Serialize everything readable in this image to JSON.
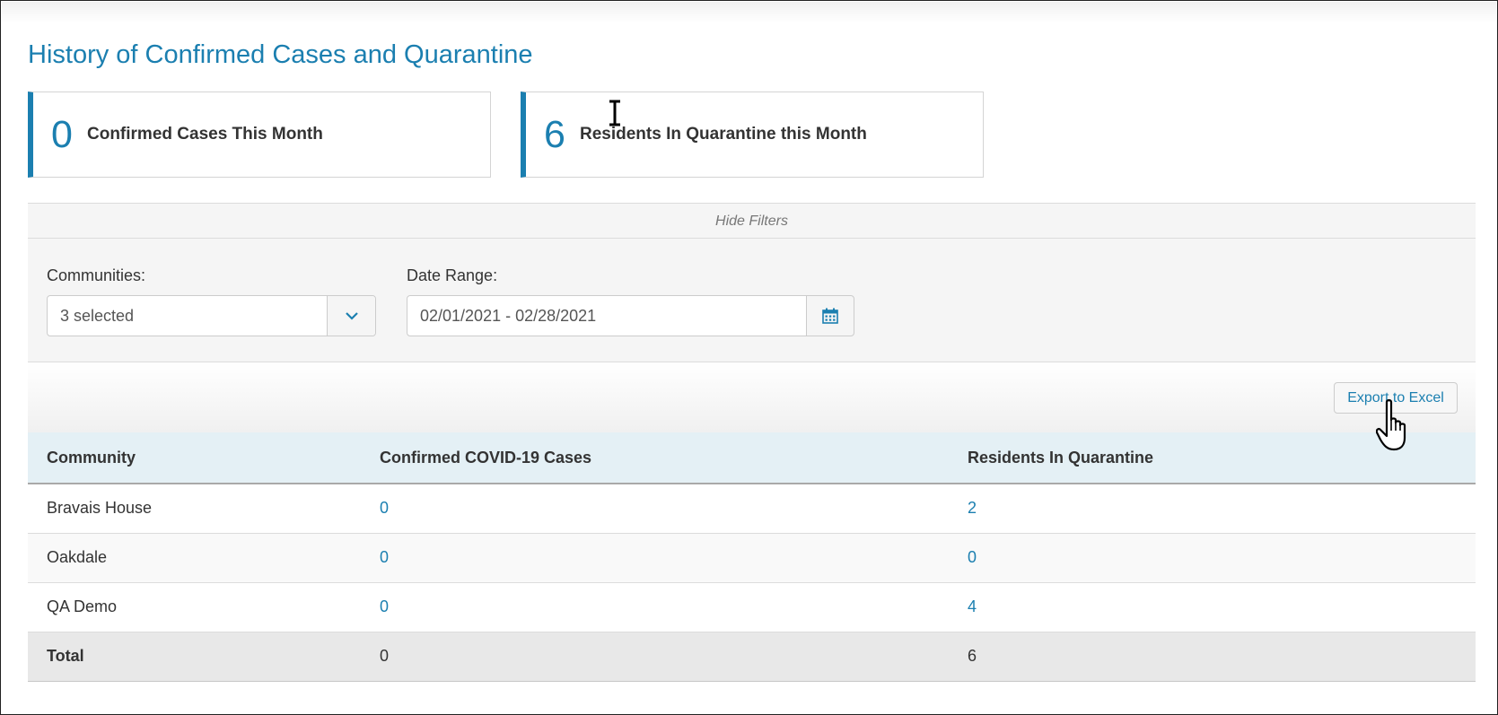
{
  "page_title": "History of Confirmed Cases and Quarantine",
  "stats": [
    {
      "value": "0",
      "label": "Confirmed Cases This Month"
    },
    {
      "value": "6",
      "label": "Residents In Quarantine this Month"
    }
  ],
  "filters": {
    "toggle_label": "Hide Filters",
    "communities_label": "Communities:",
    "communities_value": "3 selected",
    "date_range_label": "Date Range:",
    "date_range_value": "02/01/2021 - 02/28/2021"
  },
  "export_label": "Export to Excel",
  "table": {
    "headers": [
      "Community",
      "Confirmed COVID-19 Cases",
      "Residents In Quarantine"
    ],
    "rows": [
      {
        "community": "Bravais House",
        "confirmed": "0",
        "quarantine": "2"
      },
      {
        "community": "Oakdale",
        "confirmed": "0",
        "quarantine": "0"
      },
      {
        "community": "QA Demo",
        "confirmed": "0",
        "quarantine": "4"
      }
    ],
    "total": {
      "label": "Total",
      "confirmed": "0",
      "quarantine": "6"
    }
  },
  "colors": {
    "accent": "#1b7fb0",
    "header_bg": "#e4f0f5",
    "total_bg": "#e8e8e8"
  },
  "icons": {
    "communities_dropdown": "chevron-down-icon",
    "date_picker": "calendar-icon",
    "text_cursor": "text-cursor-icon",
    "mouse_pointer": "hand-pointer-icon"
  }
}
